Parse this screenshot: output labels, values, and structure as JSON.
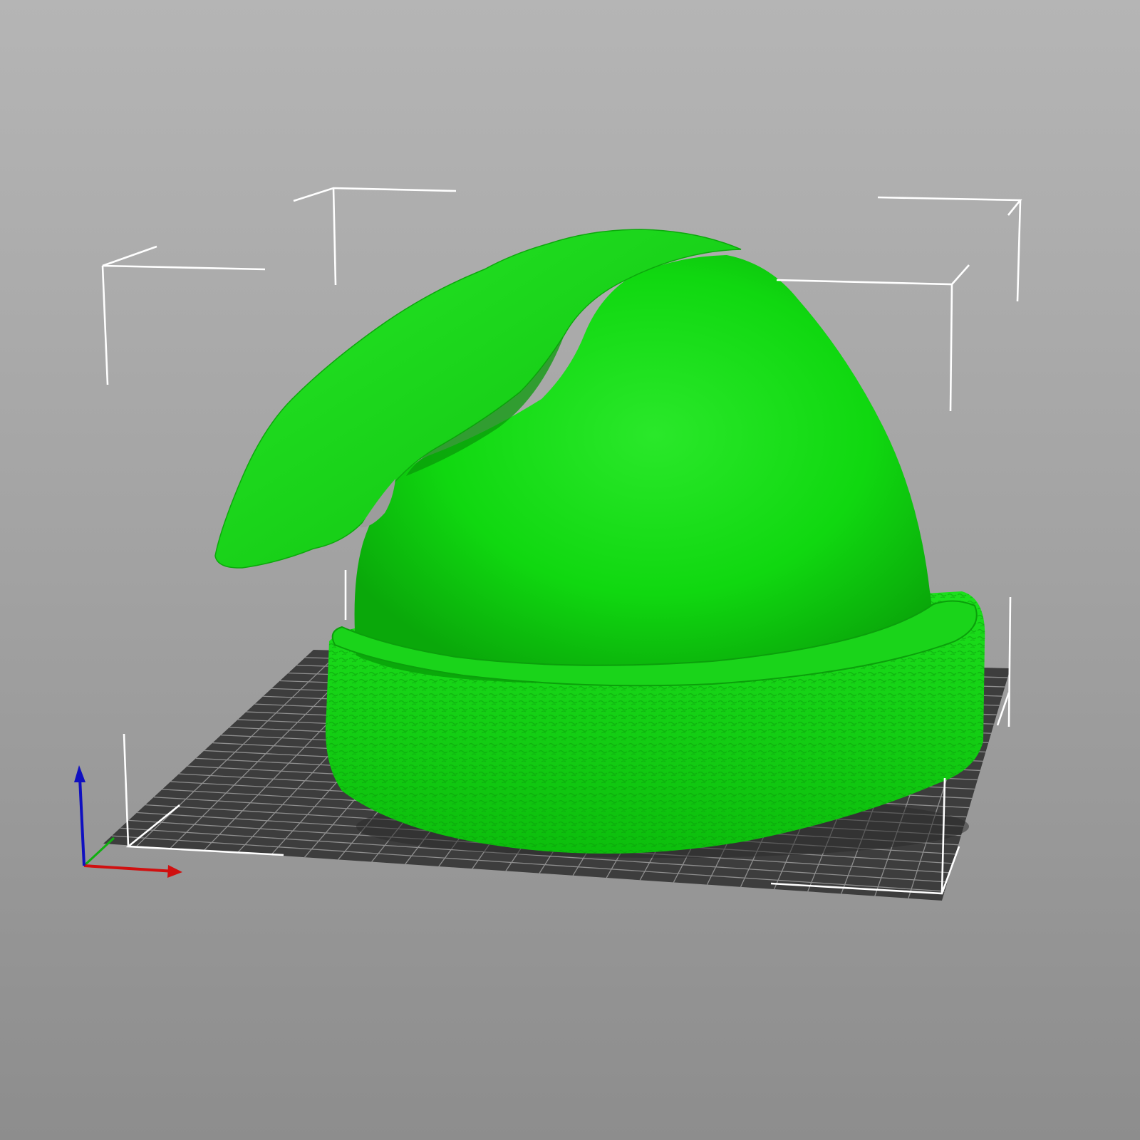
{
  "viewport": {
    "background_top": "#b5b5b5",
    "background_bottom": "#8d8d8d"
  },
  "bed": {
    "color": "#3a3a3a",
    "grid_color": "#8a8a8a"
  },
  "model": {
    "name_icon": "elf-hat-model",
    "color": "#10d810",
    "shadow_color": "#0a9e0a",
    "highlight_color": "#30ee30"
  },
  "bounding_box": {
    "color": "#ffffff"
  },
  "axes": {
    "x_color": "#d01010",
    "y_color": "#10b010",
    "z_color": "#1010c0"
  }
}
